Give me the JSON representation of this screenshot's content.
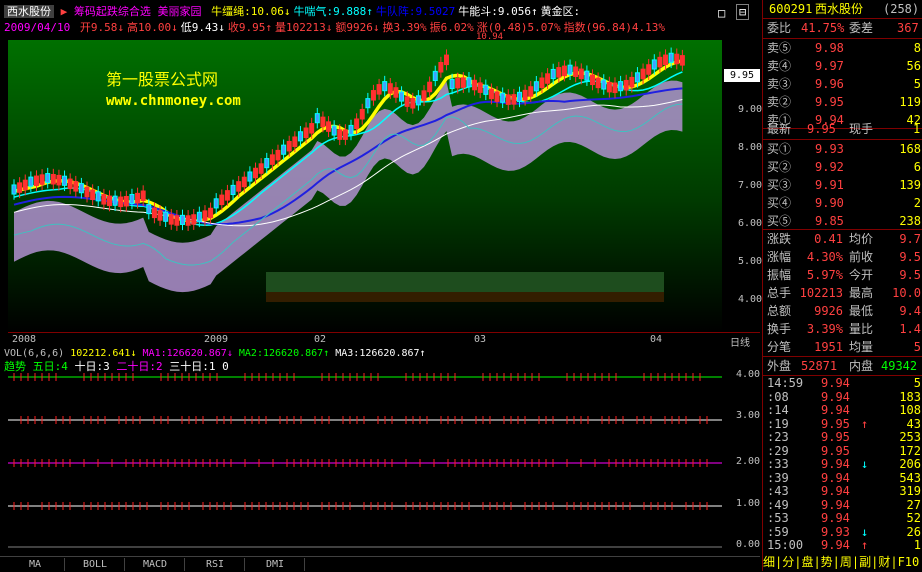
{
  "header": {
    "stock_name": "西水股份",
    "formula_names": [
      "筹码起跌综合选",
      "美丽家园"
    ],
    "indicators": [
      {
        "label": "牛缰绳:",
        "value": "10.06",
        "arrow": "↓",
        "color": "#ffff00"
      },
      {
        "label": "牛喘气:",
        "value": "9.888",
        "arrow": "↑",
        "color": "#00ffff"
      },
      {
        "label": "牛队阵:",
        "value": "9.5027",
        "arrow": "",
        "color": "#0000ff"
      },
      {
        "label": "牛能斗:",
        "value": "9.056",
        "arrow": "↑",
        "color": "#ffffff"
      },
      {
        "label": "黄金区:",
        "value": "",
        "arrow": "",
        "color": "#ffffff"
      }
    ],
    "date": "2009/04/10",
    "quote": [
      {
        "label": "开",
        "value": "9.58",
        "arrow": "↓",
        "color": "#ff4040"
      },
      {
        "label": "高",
        "value": "10.00",
        "arrow": "↓",
        "color": "#ff4040"
      },
      {
        "label": "低",
        "value": "9.43",
        "arrow": "↓",
        "color": "#ffffff"
      },
      {
        "label": "收",
        "value": "9.95",
        "arrow": "↑",
        "color": "#ff4040"
      },
      {
        "label": "量",
        "value": "102213",
        "arrow": "↓",
        "color": "#ff4040"
      },
      {
        "label": "额",
        "value": "9926",
        "arrow": "↓",
        "color": "#ff4040"
      },
      {
        "label": "换",
        "value": "3.39%",
        "arrow": "",
        "color": "#ff4040"
      },
      {
        "label": "振",
        "value": "6.02%",
        "arrow": "",
        "color": "#ff4040"
      },
      {
        "label": "涨",
        "value": "(0.48)5.07%",
        "arrow": "",
        "color": "#ff4040"
      },
      {
        "label": "指数",
        "value": "(96.84)4.13%",
        "arrow": "",
        "color": "#ff4040"
      }
    ],
    "high_mark": "10.94"
  },
  "watermark": {
    "title": "第一股票公式网",
    "url": "www.chnmoney.com"
  },
  "price_axis": {
    "labels": [
      "9.00",
      "8.00",
      "7.00",
      "6.00",
      "5.00",
      "4.00"
    ],
    "current": "9.95"
  },
  "x_axis": {
    "labels": [
      "2008",
      "2009",
      "02",
      "03",
      "04"
    ],
    "scale_label": "日线"
  },
  "volume_line": {
    "label": "VOL(6,6,6)",
    "value": "102212.641",
    "ma1": "MA1:126620.867",
    "ma2": "MA2:126620.867",
    "ma3": "MA3:126620.867"
  },
  "trend_line": {
    "title": "趋势",
    "items": [
      {
        "label": "五日:",
        "value": "4"
      },
      {
        "label": "十日:",
        "value": "3"
      },
      {
        "label": "二十日:",
        "value": "2"
      },
      {
        "label": "三十日:",
        "value": "1"
      },
      {
        "value": "0"
      }
    ]
  },
  "signal_axis": {
    "labels": [
      "4.00",
      "3.00",
      "2.00",
      "1.00",
      "0.00"
    ]
  },
  "tabs": [
    "MA",
    "BOLL",
    "MACD",
    "RSI",
    "DMI"
  ],
  "right_panel": {
    "code": "600291",
    "name": "西水股份",
    "rank": "(258)",
    "webi": {
      "label": "委比",
      "value": "41.75%",
      "diff_label": "委差",
      "diff": "367"
    },
    "sell": [
      {
        "label": "卖⑤",
        "price": "9.98",
        "vol": "8"
      },
      {
        "label": "卖④",
        "price": "9.97",
        "vol": "56"
      },
      {
        "label": "卖③",
        "price": "9.96",
        "vol": "5"
      },
      {
        "label": "卖②",
        "price": "9.95",
        "vol": "119"
      },
      {
        "label": "卖①",
        "price": "9.94",
        "vol": "42"
      }
    ],
    "latest": {
      "label": "最新",
      "price": "9.95",
      "hand_label": "现手",
      "hand": "1"
    },
    "buy": [
      {
        "label": "买①",
        "price": "9.93",
        "vol": "168"
      },
      {
        "label": "买②",
        "price": "9.92",
        "vol": "6"
      },
      {
        "label": "买③",
        "price": "9.91",
        "vol": "139"
      },
      {
        "label": "买④",
        "price": "9.90",
        "vol": "2"
      },
      {
        "label": "买⑤",
        "price": "9.85",
        "vol": "238"
      }
    ],
    "stats": [
      {
        "l1": "涨跌",
        "v1": "0.41",
        "l2": "均价",
        "v2": "9.7"
      },
      {
        "l1": "涨幅",
        "v1": "4.30%",
        "l2": "前收",
        "v2": "9.5"
      },
      {
        "l1": "振幅",
        "v1": "5.97%",
        "l2": "今开",
        "v2": "9.5"
      },
      {
        "l1": "总手",
        "v1": "102213",
        "l2": "最高",
        "v2": "10.0"
      },
      {
        "l1": "总额",
        "v1": "9926",
        "l2": "最低",
        "v2": "9.4"
      },
      {
        "l1": "换手",
        "v1": "3.39%",
        "l2": "量比",
        "v2": "1.4"
      },
      {
        "l1": "分笔",
        "v1": "1951",
        "l2": "均量",
        "v2": "5"
      }
    ],
    "outer": {
      "label": "外盘",
      "value": "52871",
      "inner_label": "内盘",
      "inner": "49342"
    },
    "ticks": [
      {
        "t": "14:59",
        "p": "9.94",
        "a": "",
        "v": "5"
      },
      {
        "t": ":08",
        "p": "9.94",
        "a": "",
        "v": "183"
      },
      {
        "t": ":14",
        "p": "9.94",
        "a": "",
        "v": "108"
      },
      {
        "t": ":19",
        "p": "9.95",
        "a": "↑",
        "v": "43"
      },
      {
        "t": ":23",
        "p": "9.95",
        "a": "",
        "v": "253"
      },
      {
        "t": ":29",
        "p": "9.95",
        "a": "",
        "v": "172"
      },
      {
        "t": ":33",
        "p": "9.94",
        "a": "↓",
        "v": "206"
      },
      {
        "t": ":39",
        "p": "9.94",
        "a": "",
        "v": "543"
      },
      {
        "t": ":43",
        "p": "9.94",
        "a": "",
        "v": "319"
      },
      {
        "t": ":49",
        "p": "9.94",
        "a": "",
        "v": "27"
      },
      {
        "t": ":53",
        "p": "9.94",
        "a": "",
        "v": "52"
      },
      {
        "t": ":59",
        "p": "9.93",
        "a": "↓",
        "v": "26"
      },
      {
        "t": "15:00",
        "p": "9.94",
        "a": "↑",
        "v": "1"
      }
    ],
    "bottom_tabs": "细|分|盘|势|周|副|财|F10|论"
  }
}
